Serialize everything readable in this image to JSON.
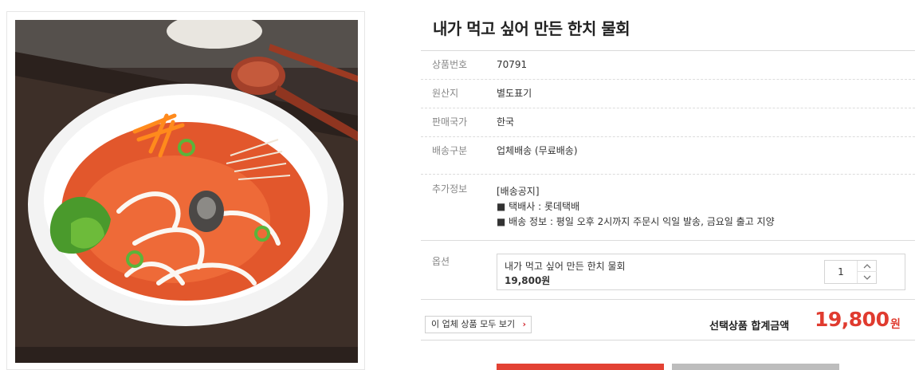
{
  "product": {
    "title": "내가 먹고 싶어 만든 한치 물회"
  },
  "info": {
    "code_label": "상품번호",
    "code_value": "70791",
    "origin_label": "원산지",
    "origin_value": "별도표기",
    "country_label": "판매국가",
    "country_value": "한국",
    "shipping_label": "배송구분",
    "shipping_value": "업체배송 (무료배송)",
    "extra_label": "추가정보",
    "extra_lines": [
      "[배송공지]",
      "■ 택배사 : 롯데택배",
      "■ 배송 정보 : 평일 오후 2시까지 주문시 익일 발송, 금요일 출고 지양"
    ]
  },
  "option": {
    "label": "옵션",
    "name": "내가 먹고 싶어 만든 한치 물회",
    "price": "19,800원",
    "quantity": "1"
  },
  "footer": {
    "vendor_button": "이 업체 상품 모두 보기",
    "total_label": "선택상품 합계금액",
    "total_amount": "19,800",
    "total_unit": "원"
  },
  "icons": {
    "qty_up": "chevron-up-icon",
    "qty_down": "chevron-down-icon",
    "vendor_arrow": "chevron-right-icon"
  },
  "colors": {
    "accent": "#e03b2f",
    "buy_button": "#e34234",
    "cart_button": "#bdbdbd"
  }
}
